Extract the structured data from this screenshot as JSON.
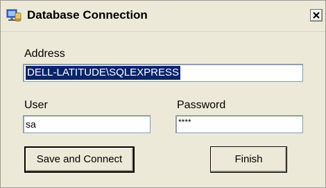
{
  "window": {
    "title": "Database Connection",
    "icon": "database-app-icon",
    "close_icon": "close-icon"
  },
  "form": {
    "address_label": "Address",
    "address_value": "DELL-LATITUDE\\SQLEXPRESS",
    "user_label": "User",
    "user_value": "sa",
    "password_label": "Password",
    "password_value": "****"
  },
  "buttons": {
    "save_connect_label": "Save and Connect",
    "finish_label": "Finish"
  },
  "colors": {
    "selection": "#0a246a",
    "dialog_bg": "#ece9d8",
    "textbox_border": "#7f9db9"
  }
}
